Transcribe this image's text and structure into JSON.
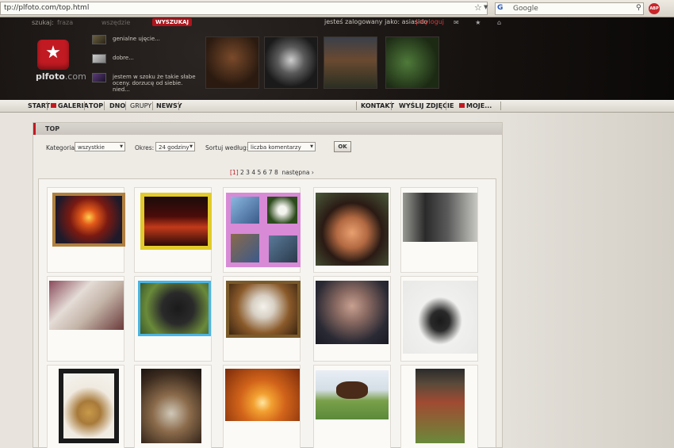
{
  "browser": {
    "url": "tp://plfoto.com/top.html",
    "search_engine": "G",
    "search_placeholder": "Google",
    "abp": "ABP"
  },
  "header": {
    "search_label": "szukaj:",
    "search_option_1": "fraza",
    "search_option_2": "wszędzie",
    "search_button": "WYSZUKAJ",
    "login_text": "jesteś zalogowany jako: asiasido",
    "logout_link": "| wyloguj",
    "logo_text": "plfoto",
    "logo_domain": ".com",
    "comments": [
      {
        "text": "genialne ujęcie..."
      },
      {
        "text": "dobre..."
      },
      {
        "text": "jestem w szoku że takie słabe oceny. dorzucę od siebie. nied..."
      }
    ]
  },
  "nav": {
    "start": "START",
    "galeria": "GALERIA",
    "top": "TOP",
    "dno": "DNO",
    "grupy": "GRUPY",
    "newsy": "NEWSY",
    "kontakt": "KONTAKT",
    "wyslij": "WYŚLIJ ZDJĘCIE",
    "moje": "MOJE..."
  },
  "panel": {
    "title": "TOP",
    "category_label": "Kategoria:",
    "category_value": "wszystkie",
    "period_label": "Okres:",
    "period_value": "24 godziny",
    "sort_label": "Sortuj według:",
    "sort_value": "liczba komentarzy",
    "ok_button": "OK",
    "pager_current": "[1]",
    "pager_pages": "2 3 4 5 6 7 8",
    "pager_next": "następna ›"
  },
  "colors": {
    "accent": "#c21a22",
    "header_bg": "#15110f"
  }
}
